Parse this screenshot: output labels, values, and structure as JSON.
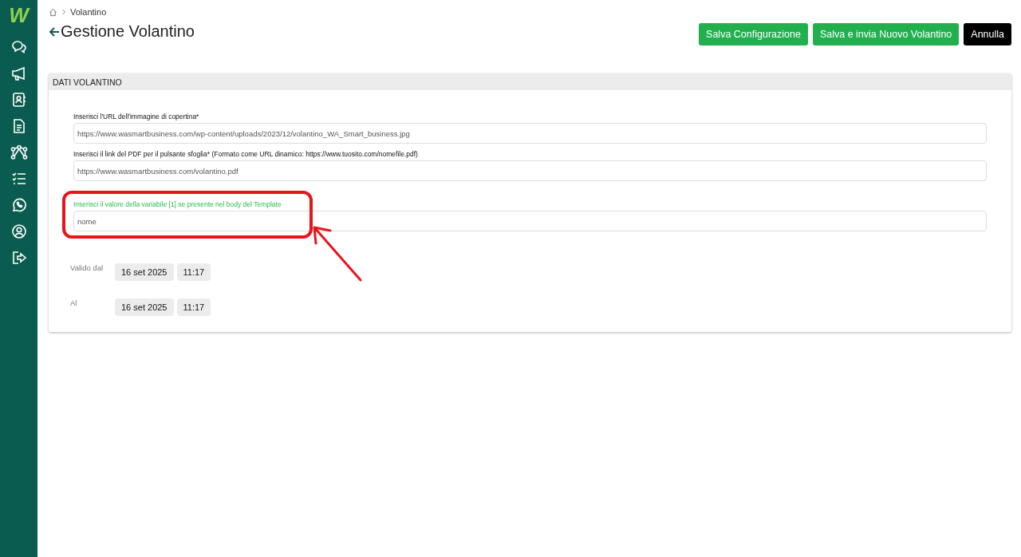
{
  "sidebar": {
    "logo": "W"
  },
  "breadcrumb": {
    "current": "Volantino"
  },
  "title": "Gestione Volantino",
  "buttons": [
    {
      "label": "Salva Configurazione",
      "kind": "primary"
    },
    {
      "label": "Salva e invia Nuovo Volantino",
      "kind": "primary"
    },
    {
      "label": "Annulla",
      "kind": "dark"
    }
  ],
  "panel": {
    "title": "DATI VOLANTINO",
    "fields": [
      {
        "label": "Inserisci l'URL dell'immagine di copertina*",
        "value": "https://www.wasmartbusiness.com/wp-content/uploads/2023/12/volantino_WA_Smart_business.jpg",
        "highlighted": false
      },
      {
        "label": "Inserisci il link del PDF per il pulsante sfoglia* (Formato come URL dinamico: https://www.tuosito.com/nomefile.pdf)",
        "value": "https://www.wasmartbusiness.com/volantino.pdf",
        "highlighted": false
      },
      {
        "label": "Inserisci il valore della variabile [1] se presente nel body del Template",
        "value": "nome",
        "highlighted": true
      }
    ],
    "dates": [
      {
        "label": "Valido dal",
        "date": "16 set 2025",
        "time": "11:17"
      },
      {
        "label": "Al",
        "date": "16 set 2025",
        "time": "11:17"
      }
    ]
  }
}
